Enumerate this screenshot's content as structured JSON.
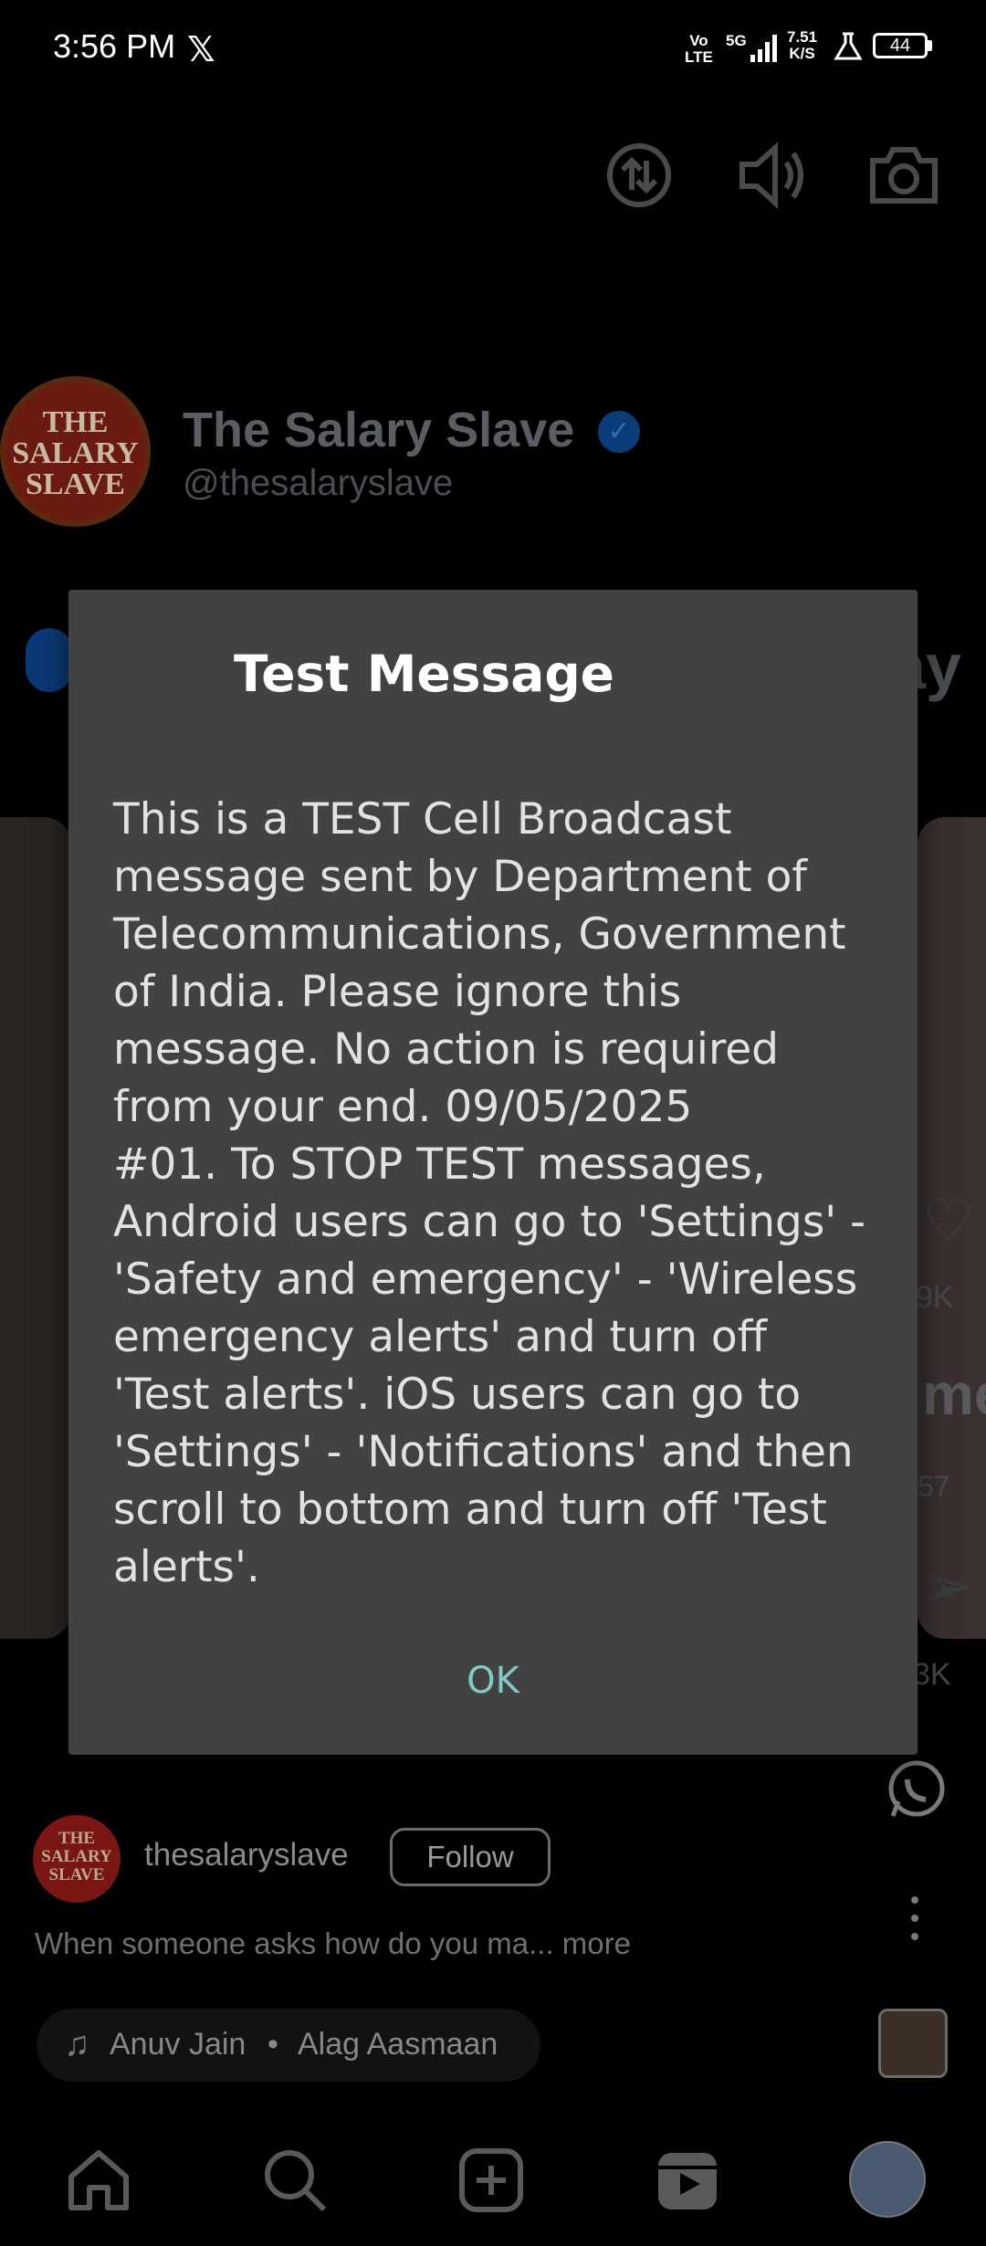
{
  "status_bar": {
    "time": "3:56 PM",
    "app_notification": "𝕏",
    "volte": "Vo\nLTE",
    "network": "5G",
    "speed": "7.51\nK/S",
    "battery": "44"
  },
  "reel": {
    "top_icons": [
      "data-saver-icon",
      "volume-icon",
      "camera-icon"
    ],
    "background": {
      "profile_name": "The Salary Slave",
      "profile_handle": "@thesalaryslave",
      "avatar_text": "THE\nSALARY\nSLAVE",
      "partial_text": "ay",
      "likes": "9K",
      "comments": "57",
      "shares": "3K",
      "partial_me": "me"
    },
    "owner": {
      "avatar_text": "THE\nSALARY\nSLAVE",
      "username": "thesalaryslave",
      "follow_label": "Follow"
    },
    "caption": "When someone asks how do you ma... more",
    "music": {
      "artist": "Anuv Jain",
      "separator": "•",
      "title": "Alag Aasmaan"
    }
  },
  "bottom_nav": [
    "home-icon",
    "search-icon",
    "create-icon",
    "reels-icon",
    "profile-avatar"
  ],
  "dialog": {
    "title": "Test Message",
    "body": "This is a TEST Cell Broadcast\nmessage sent by Department of\nTelecommunications, Government\nof India. Please ignore this\nmessage. No action is required\nfrom your end. 09/05/2025\n#01. To STOP TEST messages,\nAndroid users can go to 'Settings' -\n'Safety and emergency' - 'Wireless\nemergency alerts' and turn off\n'Test alerts'. iOS users can go to\n'Settings' - 'Notifications' and then\nscroll to bottom and turn off 'Test\nalerts'.",
    "ok_label": "OK"
  },
  "colors": {
    "dialog_bg": "#424242",
    "ok_accent": "#80cbc4",
    "page_bg": "#000000"
  }
}
